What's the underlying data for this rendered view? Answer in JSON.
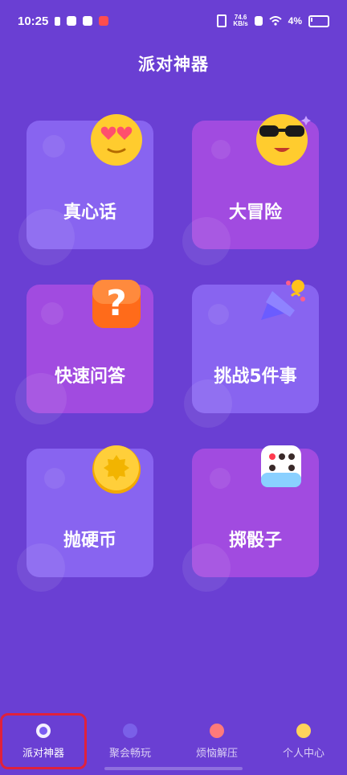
{
  "status": {
    "time": "10:25",
    "net_speed_value": "74.6",
    "net_speed_unit": "KB/s",
    "battery": "4%"
  },
  "header": {
    "title": "派对神器"
  },
  "cards": [
    {
      "label": "真心话",
      "icon": "heart-eyes-emoji-icon"
    },
    {
      "label": "大冒险",
      "icon": "sunglasses-emoji-icon"
    },
    {
      "label": "快速问答",
      "icon": "question-mark-icon"
    },
    {
      "label": "挑战5件事",
      "icon": "party-popper-icon"
    },
    {
      "label": "抛硬币",
      "icon": "coin-icon"
    },
    {
      "label": "掷骰子",
      "icon": "dice-icon"
    }
  ],
  "bottom_nav": {
    "items": [
      {
        "label": "派对神器",
        "icon": "party-icon",
        "active": true
      },
      {
        "label": "聚会畅玩",
        "icon": "face-icon"
      },
      {
        "label": "烦恼解压",
        "icon": "relief-icon"
      },
      {
        "label": "个人中心",
        "icon": "profile-icon"
      }
    ]
  },
  "colors": {
    "background": "#6a3fd3",
    "card_blue": "#8864f0",
    "card_purple": "#a14be0",
    "active_border": "#e0213c"
  }
}
